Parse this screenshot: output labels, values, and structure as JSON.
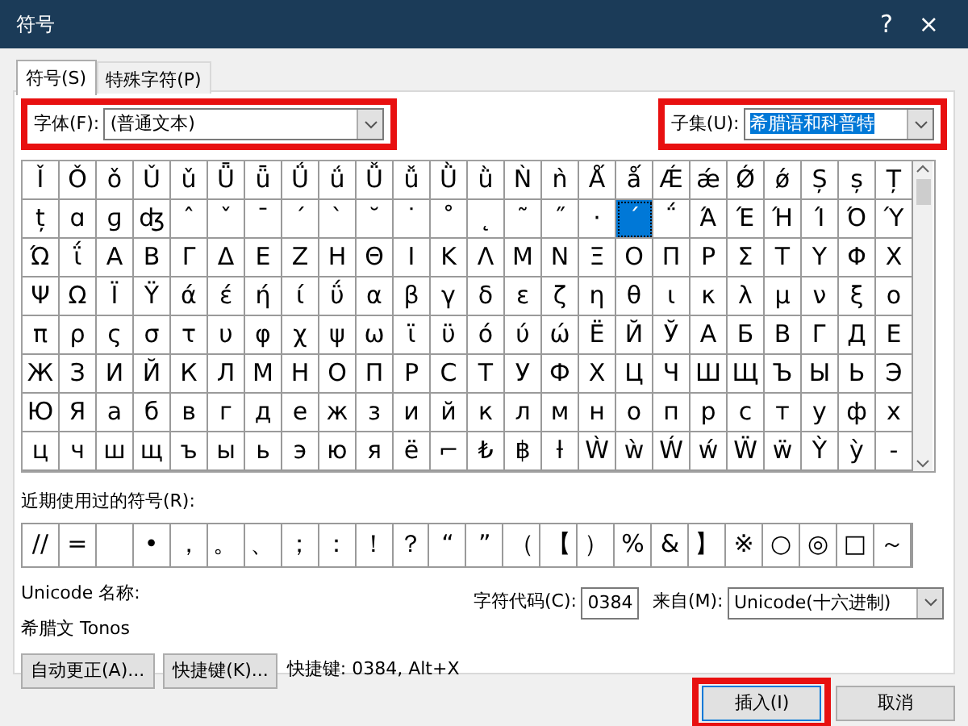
{
  "window": {
    "title": "符号",
    "help": "?",
    "close": "×"
  },
  "tabs": [
    {
      "label": "符号(S)",
      "selected": true
    },
    {
      "label": "特殊字符(P)",
      "selected": false
    }
  ],
  "font": {
    "label": "字体(F):",
    "value": "(普通文本)"
  },
  "subset": {
    "label": "子集(U):",
    "value": "希腊语和科普特"
  },
  "grid": [
    [
      {
        "char": "Ǐ",
        "selected": false
      },
      {
        "char": "Ǒ",
        "selected": false
      },
      {
        "char": "ǒ",
        "selected": false
      },
      {
        "char": "Ǔ",
        "selected": false
      },
      {
        "char": "ǔ",
        "selected": false
      },
      {
        "char": "Ǖ",
        "selected": false
      },
      {
        "char": "ǖ",
        "selected": false
      },
      {
        "char": "Ǘ",
        "selected": false
      },
      {
        "char": "ǘ",
        "selected": false
      },
      {
        "char": "Ǚ",
        "selected": false
      },
      {
        "char": "ǚ",
        "selected": false
      },
      {
        "char": "Ǜ",
        "selected": false
      },
      {
        "char": "ǜ",
        "selected": false
      },
      {
        "char": "Ǹ",
        "selected": false
      },
      {
        "char": "ǹ",
        "selected": false
      },
      {
        "char": "Ǻ",
        "selected": false
      },
      {
        "char": "ǻ",
        "selected": false
      },
      {
        "char": "Ǽ",
        "selected": false
      },
      {
        "char": "ǽ",
        "selected": false
      },
      {
        "char": "Ǿ",
        "selected": false
      },
      {
        "char": "ǿ",
        "selected": false
      },
      {
        "char": "Ș",
        "selected": false
      },
      {
        "char": "ș",
        "selected": false
      },
      {
        "char": "Ț",
        "selected": false
      }
    ],
    [
      {
        "char": "ț",
        "selected": false
      },
      {
        "char": "ɑ",
        "selected": false
      },
      {
        "char": "ɡ",
        "selected": false
      },
      {
        "char": "ʤ",
        "selected": false
      },
      {
        "char": "ˆ",
        "selected": false
      },
      {
        "char": "ˇ",
        "selected": false
      },
      {
        "char": "ˉ",
        "selected": false
      },
      {
        "char": "ˊ",
        "selected": false
      },
      {
        "char": "ˋ",
        "selected": false
      },
      {
        "char": "˘",
        "selected": false
      },
      {
        "char": "˙",
        "selected": false
      },
      {
        "char": "˚",
        "selected": false
      },
      {
        "char": "˛",
        "selected": false
      },
      {
        "char": "˜",
        "selected": false
      },
      {
        "char": "˝",
        "selected": false
      },
      {
        "char": "·",
        "selected": false
      },
      {
        "char": "΄",
        "selected": true
      },
      {
        "char": "΅",
        "selected": false
      },
      {
        "char": "Ά",
        "selected": false
      },
      {
        "char": "Έ",
        "selected": false
      },
      {
        "char": "Ή",
        "selected": false
      },
      {
        "char": "Ί",
        "selected": false
      },
      {
        "char": "Ό",
        "selected": false
      },
      {
        "char": "Ύ",
        "selected": false
      }
    ],
    [
      {
        "char": "Ώ",
        "selected": false
      },
      {
        "char": "ΐ",
        "selected": false
      },
      {
        "char": "Α",
        "selected": false
      },
      {
        "char": "Β",
        "selected": false
      },
      {
        "char": "Γ",
        "selected": false
      },
      {
        "char": "Δ",
        "selected": false
      },
      {
        "char": "Ε",
        "selected": false
      },
      {
        "char": "Ζ",
        "selected": false
      },
      {
        "char": "Η",
        "selected": false
      },
      {
        "char": "Θ",
        "selected": false
      },
      {
        "char": "Ι",
        "selected": false
      },
      {
        "char": "Κ",
        "selected": false
      },
      {
        "char": "Λ",
        "selected": false
      },
      {
        "char": "Μ",
        "selected": false
      },
      {
        "char": "Ν",
        "selected": false
      },
      {
        "char": "Ξ",
        "selected": false
      },
      {
        "char": "Ο",
        "selected": false
      },
      {
        "char": "Π",
        "selected": false
      },
      {
        "char": "Ρ",
        "selected": false
      },
      {
        "char": "Σ",
        "selected": false
      },
      {
        "char": "Τ",
        "selected": false
      },
      {
        "char": "Υ",
        "selected": false
      },
      {
        "char": "Φ",
        "selected": false
      },
      {
        "char": "Χ",
        "selected": false
      }
    ],
    [
      {
        "char": "Ψ",
        "selected": false
      },
      {
        "char": "Ω",
        "selected": false
      },
      {
        "char": "Ϊ",
        "selected": false
      },
      {
        "char": "Ϋ",
        "selected": false
      },
      {
        "char": "ά",
        "selected": false
      },
      {
        "char": "έ",
        "selected": false
      },
      {
        "char": "ή",
        "selected": false
      },
      {
        "char": "ί",
        "selected": false
      },
      {
        "char": "ΰ",
        "selected": false
      },
      {
        "char": "α",
        "selected": false
      },
      {
        "char": "β",
        "selected": false
      },
      {
        "char": "γ",
        "selected": false
      },
      {
        "char": "δ",
        "selected": false
      },
      {
        "char": "ε",
        "selected": false
      },
      {
        "char": "ζ",
        "selected": false
      },
      {
        "char": "η",
        "selected": false
      },
      {
        "char": "θ",
        "selected": false
      },
      {
        "char": "ι",
        "selected": false
      },
      {
        "char": "κ",
        "selected": false
      },
      {
        "char": "λ",
        "selected": false
      },
      {
        "char": "μ",
        "selected": false
      },
      {
        "char": "ν",
        "selected": false
      },
      {
        "char": "ξ",
        "selected": false
      },
      {
        "char": "ο",
        "selected": false
      }
    ],
    [
      {
        "char": "π",
        "selected": false
      },
      {
        "char": "ρ",
        "selected": false
      },
      {
        "char": "ς",
        "selected": false
      },
      {
        "char": "σ",
        "selected": false
      },
      {
        "char": "τ",
        "selected": false
      },
      {
        "char": "υ",
        "selected": false
      },
      {
        "char": "φ",
        "selected": false
      },
      {
        "char": "χ",
        "selected": false
      },
      {
        "char": "ψ",
        "selected": false
      },
      {
        "char": "ω",
        "selected": false
      },
      {
        "char": "ϊ",
        "selected": false
      },
      {
        "char": "ϋ",
        "selected": false
      },
      {
        "char": "ό",
        "selected": false
      },
      {
        "char": "ύ",
        "selected": false
      },
      {
        "char": "ώ",
        "selected": false
      },
      {
        "char": "Ё",
        "selected": false
      },
      {
        "char": "Й",
        "selected": false
      },
      {
        "char": "Ў",
        "selected": false
      },
      {
        "char": "А",
        "selected": false
      },
      {
        "char": "Б",
        "selected": false
      },
      {
        "char": "В",
        "selected": false
      },
      {
        "char": "Г",
        "selected": false
      },
      {
        "char": "Д",
        "selected": false
      },
      {
        "char": "Е",
        "selected": false
      }
    ],
    [
      {
        "char": "Ж",
        "selected": false
      },
      {
        "char": "З",
        "selected": false
      },
      {
        "char": "И",
        "selected": false
      },
      {
        "char": "Й",
        "selected": false
      },
      {
        "char": "К",
        "selected": false
      },
      {
        "char": "Л",
        "selected": false
      },
      {
        "char": "М",
        "selected": false
      },
      {
        "char": "Н",
        "selected": false
      },
      {
        "char": "О",
        "selected": false
      },
      {
        "char": "П",
        "selected": false
      },
      {
        "char": "Р",
        "selected": false
      },
      {
        "char": "С",
        "selected": false
      },
      {
        "char": "Т",
        "selected": false
      },
      {
        "char": "У",
        "selected": false
      },
      {
        "char": "Ф",
        "selected": false
      },
      {
        "char": "Х",
        "selected": false
      },
      {
        "char": "Ц",
        "selected": false
      },
      {
        "char": "Ч",
        "selected": false
      },
      {
        "char": "Ш",
        "selected": false
      },
      {
        "char": "Щ",
        "selected": false
      },
      {
        "char": "Ъ",
        "selected": false
      },
      {
        "char": "Ы",
        "selected": false
      },
      {
        "char": "Ь",
        "selected": false
      },
      {
        "char": "Э",
        "selected": false
      }
    ],
    [
      {
        "char": "Ю",
        "selected": false
      },
      {
        "char": "Я",
        "selected": false
      },
      {
        "char": "а",
        "selected": false
      },
      {
        "char": "б",
        "selected": false
      },
      {
        "char": "в",
        "selected": false
      },
      {
        "char": "г",
        "selected": false
      },
      {
        "char": "д",
        "selected": false
      },
      {
        "char": "е",
        "selected": false
      },
      {
        "char": "ж",
        "selected": false
      },
      {
        "char": "з",
        "selected": false
      },
      {
        "char": "и",
        "selected": false
      },
      {
        "char": "й",
        "selected": false
      },
      {
        "char": "к",
        "selected": false
      },
      {
        "char": "л",
        "selected": false
      },
      {
        "char": "м",
        "selected": false
      },
      {
        "char": "н",
        "selected": false
      },
      {
        "char": "о",
        "selected": false
      },
      {
        "char": "п",
        "selected": false
      },
      {
        "char": "р",
        "selected": false
      },
      {
        "char": "с",
        "selected": false
      },
      {
        "char": "т",
        "selected": false
      },
      {
        "char": "у",
        "selected": false
      },
      {
        "char": "ф",
        "selected": false
      },
      {
        "char": "х",
        "selected": false
      }
    ],
    [
      {
        "char": "ц",
        "selected": false
      },
      {
        "char": "ч",
        "selected": false
      },
      {
        "char": "ш",
        "selected": false
      },
      {
        "char": "щ",
        "selected": false
      },
      {
        "char": "ъ",
        "selected": false
      },
      {
        "char": "ы",
        "selected": false
      },
      {
        "char": "ь",
        "selected": false
      },
      {
        "char": "э",
        "selected": false
      },
      {
        "char": "ю",
        "selected": false
      },
      {
        "char": "я",
        "selected": false
      },
      {
        "char": "ё",
        "selected": false
      },
      {
        "char": "⌐",
        "selected": false
      },
      {
        "char": "₺",
        "selected": false
      },
      {
        "char": "฿",
        "selected": false
      },
      {
        "char": "ƚ",
        "selected": false
      },
      {
        "char": "Ẁ",
        "selected": false
      },
      {
        "char": "ẁ",
        "selected": false
      },
      {
        "char": "Ẃ",
        "selected": false
      },
      {
        "char": "ẃ",
        "selected": false
      },
      {
        "char": "Ẅ",
        "selected": false
      },
      {
        "char": "ẅ",
        "selected": false
      },
      {
        "char": "Ỳ",
        "selected": false
      },
      {
        "char": "ỳ",
        "selected": false
      },
      {
        "char": "‐",
        "selected": false
      }
    ]
  ],
  "recent": {
    "label": "近期使用过的符号(R):",
    "symbols": [
      {
        "kind": "char",
        "char": "//"
      },
      {
        "kind": "char",
        "char": "="
      },
      {
        "kind": "blank"
      },
      {
        "kind": "char",
        "char": "•"
      },
      {
        "kind": "char",
        "char": "，"
      },
      {
        "kind": "char",
        "char": "。"
      },
      {
        "kind": "char",
        "char": "、"
      },
      {
        "kind": "char",
        "char": "；"
      },
      {
        "kind": "char",
        "char": "："
      },
      {
        "kind": "char",
        "char": "！"
      },
      {
        "kind": "char",
        "char": "？"
      },
      {
        "kind": "char",
        "char": "“"
      },
      {
        "kind": "char",
        "char": "”"
      },
      {
        "kind": "char",
        "char": "（"
      },
      {
        "kind": "char",
        "char": "【"
      },
      {
        "kind": "char",
        "char": "）"
      },
      {
        "kind": "char",
        "char": "%"
      },
      {
        "kind": "char",
        "char": "&"
      },
      {
        "kind": "char",
        "char": "】"
      },
      {
        "kind": "char",
        "char": "※"
      },
      {
        "kind": "char",
        "char": "○"
      },
      {
        "kind": "char",
        "char": "◎"
      },
      {
        "kind": "char",
        "char": "□"
      },
      {
        "kind": "char",
        "char": "～"
      }
    ]
  },
  "unicode_name": {
    "label": "Unicode 名称:",
    "value": "希腊文 Tonos"
  },
  "char_code": {
    "label": "字符代码(C):",
    "value": "0384"
  },
  "from": {
    "label": "来自(M):",
    "value": "Unicode(十六进制)"
  },
  "buttons": [
    "自动更正(A)...",
    "快捷键(K)..."
  ],
  "shortcut_text": "快捷键: 0384, Alt+X",
  "footer_buttons": [
    {
      "label": "插入(I)",
      "kind": "default"
    },
    {
      "label": "取消",
      "kind": "normal"
    }
  ]
}
